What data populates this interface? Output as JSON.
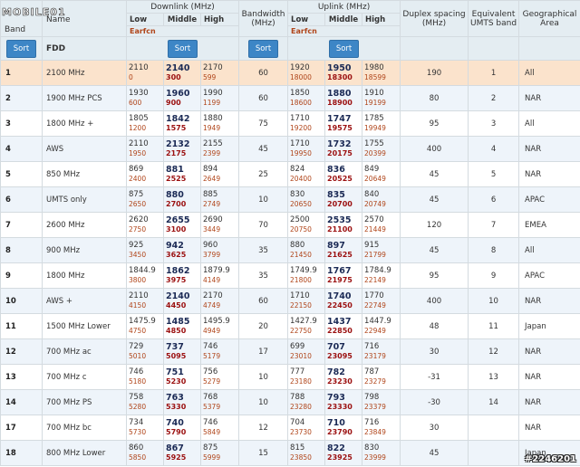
{
  "logo": {
    "text": "MOBILE01"
  },
  "headers": {
    "band": "Band",
    "name": "Name",
    "downlink": "Downlink (MHz)",
    "bandwidth_l1": "Bandwidth",
    "bandwidth_l2": "(MHz)",
    "uplink": "Uplink (MHz)",
    "duplex_l1": "Duplex spacing",
    "duplex_l2": "(MHz)",
    "umts_l1": "Equivalent",
    "umts_l2": "UMTS band",
    "geo_l1": "Geographical",
    "geo_l2": "Area",
    "low": "Low",
    "middle": "Middle",
    "high": "High",
    "earfcn": "Earfcn",
    "sort": "Sort",
    "fdd": "FDD"
  },
  "rows": [
    {
      "band": "1",
      "name": "2100 MHz",
      "dl": [
        "2110",
        "0",
        "2140",
        "300",
        "2170",
        "599"
      ],
      "bw": "60",
      "ul": [
        "1920",
        "18000",
        "1950",
        "18300",
        "1980",
        "18599"
      ],
      "duplex": "190",
      "umts": "1",
      "geo": "All",
      "highlight": true
    },
    {
      "band": "2",
      "name": "1900 MHz PCS",
      "dl": [
        "1930",
        "600",
        "1960",
        "900",
        "1990",
        "1199"
      ],
      "bw": "60",
      "ul": [
        "1850",
        "18600",
        "1880",
        "18900",
        "1910",
        "19199"
      ],
      "duplex": "80",
      "umts": "2",
      "geo": "NAR"
    },
    {
      "band": "3",
      "name": "1800 MHz +",
      "dl": [
        "1805",
        "1200",
        "1842",
        "1575",
        "1880",
        "1949"
      ],
      "bw": "75",
      "ul": [
        "1710",
        "19200",
        "1747",
        "19575",
        "1785",
        "19949"
      ],
      "duplex": "95",
      "umts": "3",
      "geo": "All"
    },
    {
      "band": "4",
      "name": "AWS",
      "dl": [
        "2110",
        "1950",
        "2132",
        "2175",
        "2155",
        "2399"
      ],
      "bw": "45",
      "ul": [
        "1710",
        "19950",
        "1732",
        "20175",
        "1755",
        "20399"
      ],
      "duplex": "400",
      "umts": "4",
      "geo": "NAR"
    },
    {
      "band": "5",
      "name": "850 MHz",
      "dl": [
        "869",
        "2400",
        "881",
        "2525",
        "894",
        "2649"
      ],
      "bw": "25",
      "ul": [
        "824",
        "20400",
        "836",
        "20525",
        "849",
        "20649"
      ],
      "duplex": "45",
      "umts": "5",
      "geo": "NAR"
    },
    {
      "band": "6",
      "name": "UMTS only",
      "dl": [
        "875",
        "2650",
        "880",
        "2700",
        "885",
        "2749"
      ],
      "bw": "10",
      "ul": [
        "830",
        "20650",
        "835",
        "20700",
        "840",
        "20749"
      ],
      "duplex": "45",
      "umts": "6",
      "geo": "APAC"
    },
    {
      "band": "7",
      "name": "2600 MHz",
      "dl": [
        "2620",
        "2750",
        "2655",
        "3100",
        "2690",
        "3449"
      ],
      "bw": "70",
      "ul": [
        "2500",
        "20750",
        "2535",
        "21100",
        "2570",
        "21449"
      ],
      "duplex": "120",
      "umts": "7",
      "geo": "EMEA"
    },
    {
      "band": "8",
      "name": "900 MHz",
      "dl": [
        "925",
        "3450",
        "942",
        "3625",
        "960",
        "3799"
      ],
      "bw": "35",
      "ul": [
        "880",
        "21450",
        "897",
        "21625",
        "915",
        "21799"
      ],
      "duplex": "45",
      "umts": "8",
      "geo": "All"
    },
    {
      "band": "9",
      "name": "1800 MHz",
      "dl": [
        "1844.9",
        "3800",
        "1862",
        "3975",
        "1879.9",
        "4149"
      ],
      "bw": "35",
      "ul": [
        "1749.9",
        "21800",
        "1767",
        "21975",
        "1784.9",
        "22149"
      ],
      "duplex": "95",
      "umts": "9",
      "geo": "APAC"
    },
    {
      "band": "10",
      "name": "AWS +",
      "dl": [
        "2110",
        "4150",
        "2140",
        "4450",
        "2170",
        "4749"
      ],
      "bw": "60",
      "ul": [
        "1710",
        "22150",
        "1740",
        "22450",
        "1770",
        "22749"
      ],
      "duplex": "400",
      "umts": "10",
      "geo": "NAR"
    },
    {
      "band": "11",
      "name": "1500 MHz Lower",
      "dl": [
        "1475.9",
        "4750",
        "1485",
        "4850",
        "1495.9",
        "4949"
      ],
      "bw": "20",
      "ul": [
        "1427.9",
        "22750",
        "1437",
        "22850",
        "1447.9",
        "22949"
      ],
      "duplex": "48",
      "umts": "11",
      "geo": "Japan"
    },
    {
      "band": "12",
      "name": "700 MHz ac",
      "dl": [
        "729",
        "5010",
        "737",
        "5095",
        "746",
        "5179"
      ],
      "bw": "17",
      "ul": [
        "699",
        "23010",
        "707",
        "23095",
        "716",
        "23179"
      ],
      "duplex": "30",
      "umts": "12",
      "geo": "NAR"
    },
    {
      "band": "13",
      "name": "700 MHz c",
      "dl": [
        "746",
        "5180",
        "751",
        "5230",
        "756",
        "5279"
      ],
      "bw": "10",
      "ul": [
        "777",
        "23180",
        "782",
        "23230",
        "787",
        "23279"
      ],
      "duplex": "-31",
      "umts": "13",
      "geo": "NAR"
    },
    {
      "band": "14",
      "name": "700 MHz PS",
      "dl": [
        "758",
        "5280",
        "763",
        "5330",
        "768",
        "5379"
      ],
      "bw": "10",
      "ul": [
        "788",
        "23280",
        "793",
        "23330",
        "798",
        "23379"
      ],
      "duplex": "-30",
      "umts": "14",
      "geo": "NAR"
    },
    {
      "band": "17",
      "name": "700 MHz bc",
      "dl": [
        "734",
        "5730",
        "740",
        "5790",
        "746",
        "5849"
      ],
      "bw": "12",
      "ul": [
        "704",
        "23730",
        "710",
        "23790",
        "716",
        "23849"
      ],
      "duplex": "30",
      "umts": "",
      "geo": "NAR"
    },
    {
      "band": "18",
      "name": "800 MHz Lower",
      "dl": [
        "860",
        "5850",
        "867",
        "5925",
        "875",
        "5999"
      ],
      "bw": "15",
      "ul": [
        "815",
        "23850",
        "822",
        "23925",
        "830",
        "23999"
      ],
      "duplex": "45",
      "umts": "",
      "geo": "Japan"
    }
  ],
  "watermark": "#2246201"
}
